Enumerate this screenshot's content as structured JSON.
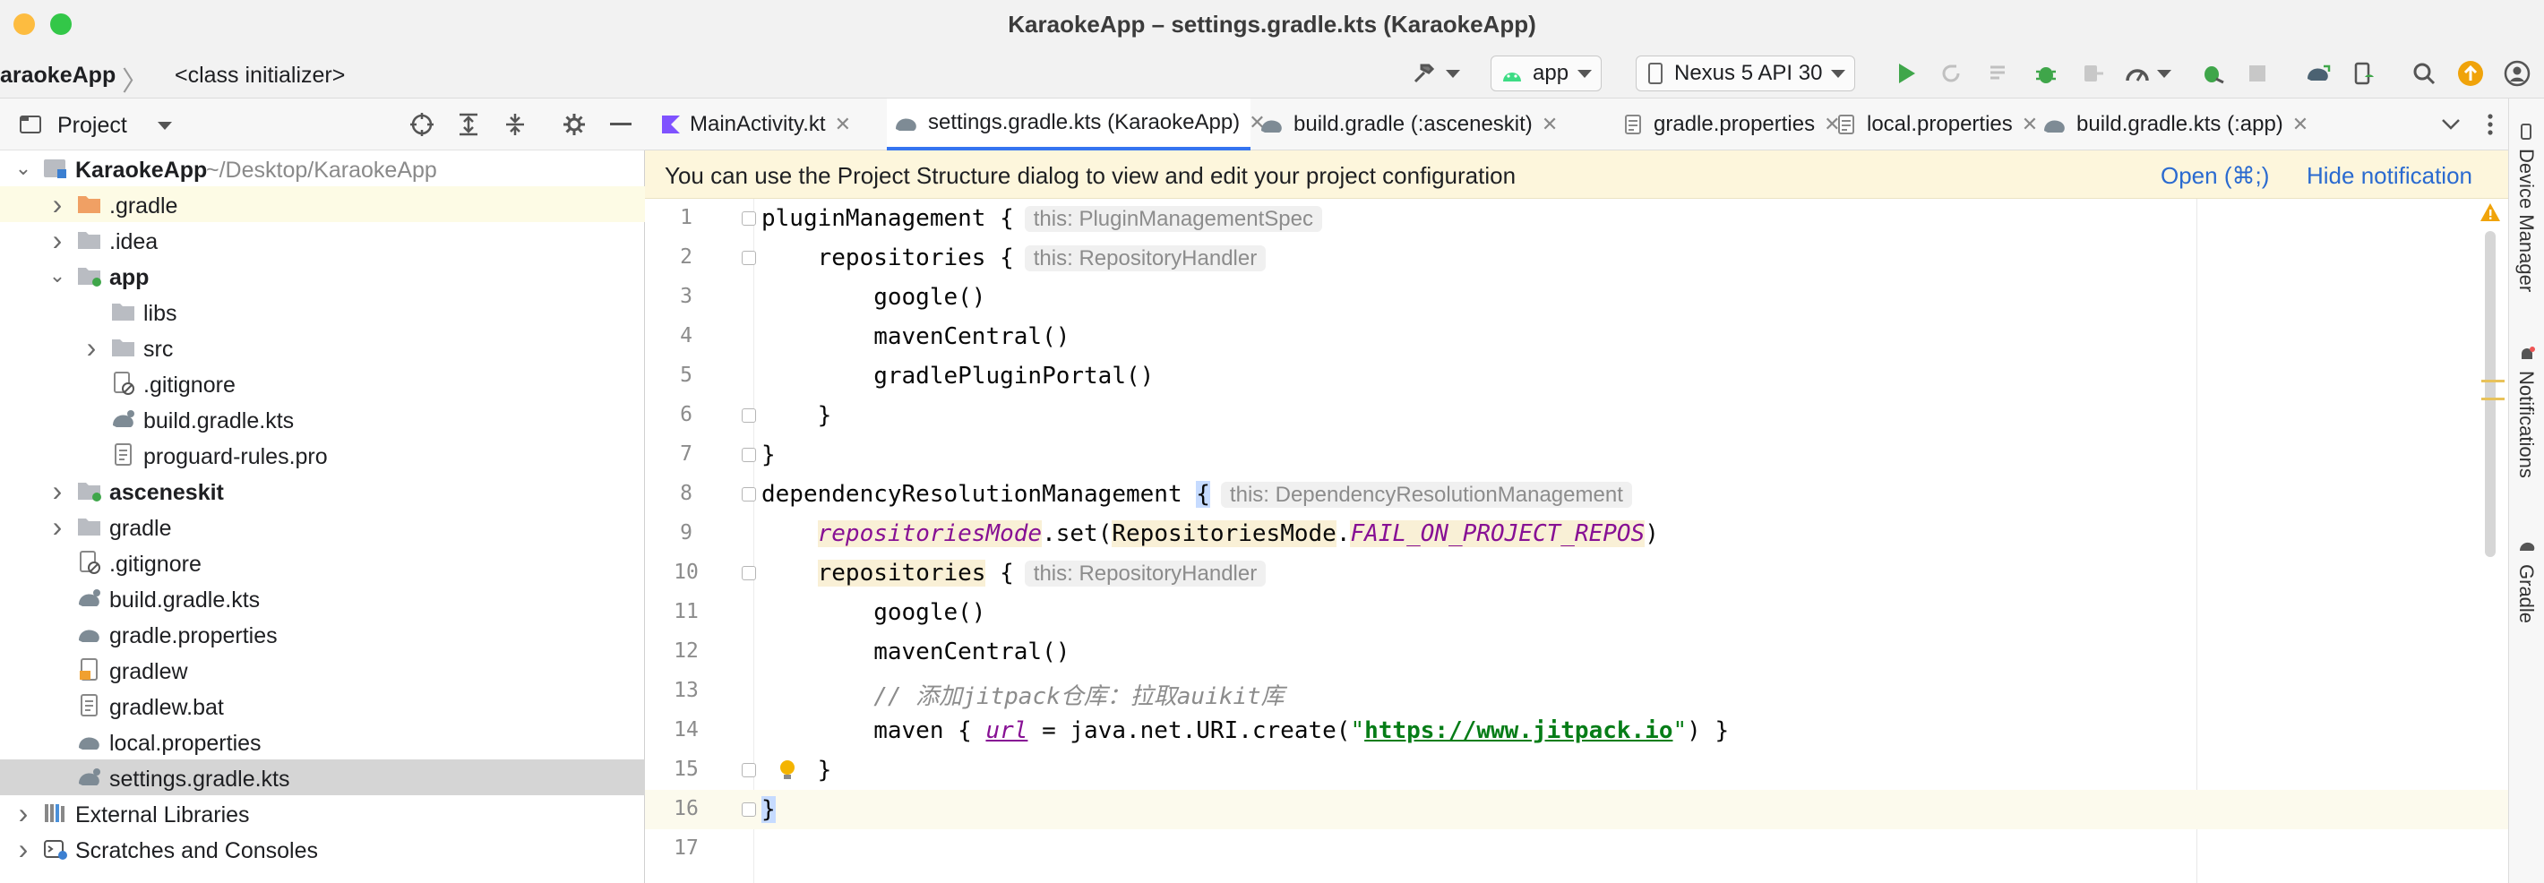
{
  "window": {
    "title": "KaraokeApp – settings.gradle.kts (KaraokeApp)"
  },
  "navbar": {
    "breadcrumb_project": "araokeApp",
    "breadcrumb_sep": "〉",
    "breadcrumb_item": "<class initializer>",
    "run_config": "app",
    "device": "Nexus 5 API 30"
  },
  "project_panel": {
    "title": "Project",
    "tree": [
      {
        "label": "KaraokeApp",
        "sub": "~/Desktop/KaraokeApp",
        "depth": 0,
        "arrow": "down",
        "icon": "module",
        "bold": true
      },
      {
        "label": ".gradle",
        "depth": 1,
        "arrow": "right",
        "icon": "folder-orange",
        "highlight": true
      },
      {
        "label": ".idea",
        "depth": 1,
        "arrow": "right",
        "icon": "folder"
      },
      {
        "label": "app",
        "depth": 1,
        "arrow": "down",
        "icon": "folder-module",
        "bold": true
      },
      {
        "label": "libs",
        "depth": 2,
        "arrow": "",
        "icon": "folder"
      },
      {
        "label": "src",
        "depth": 2,
        "arrow": "right",
        "icon": "folder"
      },
      {
        "label": ".gitignore",
        "depth": 2,
        "arrow": "",
        "icon": "file-ignore"
      },
      {
        "label": "build.gradle.kts",
        "depth": 2,
        "arrow": "",
        "icon": "gradle"
      },
      {
        "label": "proguard-rules.pro",
        "depth": 2,
        "arrow": "",
        "icon": "file"
      },
      {
        "label": "asceneskit",
        "depth": 1,
        "arrow": "right",
        "icon": "folder-module",
        "bold": true
      },
      {
        "label": "gradle",
        "depth": 1,
        "arrow": "right",
        "icon": "folder"
      },
      {
        "label": ".gitignore",
        "depth": 1,
        "arrow": "",
        "icon": "file-ignore"
      },
      {
        "label": "build.gradle.kts",
        "depth": 1,
        "arrow": "",
        "icon": "gradle"
      },
      {
        "label": "gradle.properties",
        "depth": 1,
        "arrow": "",
        "icon": "properties"
      },
      {
        "label": "gradlew",
        "depth": 1,
        "arrow": "",
        "icon": "shell"
      },
      {
        "label": "gradlew.bat",
        "depth": 1,
        "arrow": "",
        "icon": "file"
      },
      {
        "label": "local.properties",
        "depth": 1,
        "arrow": "",
        "icon": "properties"
      },
      {
        "label": "settings.gradle.kts",
        "depth": 1,
        "arrow": "",
        "icon": "gradle",
        "selected": true
      },
      {
        "label": "External Libraries",
        "depth": 0,
        "arrow": "right",
        "icon": "libraries"
      },
      {
        "label": "Scratches and Consoles",
        "depth": 0,
        "arrow": "right",
        "icon": "scratches"
      }
    ]
  },
  "tabs": [
    {
      "label": "MainActivity.kt",
      "icon": "kotlin"
    },
    {
      "label": "settings.gradle.kts (KaraokeApp)",
      "icon": "gradle",
      "active": true
    },
    {
      "label": "build.gradle (:asceneskit)",
      "icon": "gradle"
    },
    {
      "label": "gradle.properties",
      "icon": "properties"
    },
    {
      "label": "local.properties",
      "icon": "properties"
    },
    {
      "label": "build.gradle.kts (:app)",
      "icon": "gradle"
    }
  ],
  "banner": {
    "text": "You can use the Project Structure dialog to view and edit your project configuration",
    "open_link": "Open (⌘;)",
    "hide_link": "Hide notification"
  },
  "editor": {
    "line_numbers": [
      "1",
      "2",
      "3",
      "4",
      "5",
      "6",
      "7",
      "8",
      "9",
      "10",
      "11",
      "12",
      "13",
      "14",
      "15",
      "16",
      "17"
    ],
    "code": {
      "l1": "pluginManagement {",
      "l1_hint": "this: PluginManagementSpec",
      "l2": "    repositories {",
      "l2_hint": "this: RepositoryHandler",
      "l3": "        google()",
      "l4": "        mavenCentral()",
      "l5": "        gradlePluginPortal()",
      "l6": "    }",
      "l7": "}",
      "l8": "dependencyResolutionManagement ",
      "l8_brace": "{",
      "l8_hint": "this: DependencyResolutionManagement",
      "l9_prop": "repositoriesMode",
      "l9_set": ".set(",
      "l9_obj": "RepositoriesMode",
      "l9_dot": ".",
      "l9_enum": "FAIL_ON_PROJECT_REPOS",
      "l9_close": ")",
      "l10_name": "repositories",
      "l10_brace": " {",
      "l10_hint": "this: RepositoryHandler",
      "l11": "        google()",
      "l12": "        mavenCentral()",
      "l13": "        // 添加jitpack仓库：拉取auikit库",
      "l14_pre": "        maven { ",
      "l14_url": "url",
      "l14_mid": " = java.net.URI.create(",
      "l14_q1": "\"",
      "l14_link": "https://www.jitpack.io",
      "l14_q2": "\"",
      "l14_end": ") }",
      "l15": "    }",
      "l16": "}",
      "l17": ""
    }
  },
  "right_stripe": {
    "device_manager": "Device Manager",
    "notifications": "Notifications",
    "gradle": "Gradle"
  },
  "colors": {
    "accent": "#3574f0",
    "banner_bg": "#fdf6dc",
    "selection": "#d5d5d5",
    "run_green": "#3fa64a",
    "warning": "#f0a30a"
  }
}
